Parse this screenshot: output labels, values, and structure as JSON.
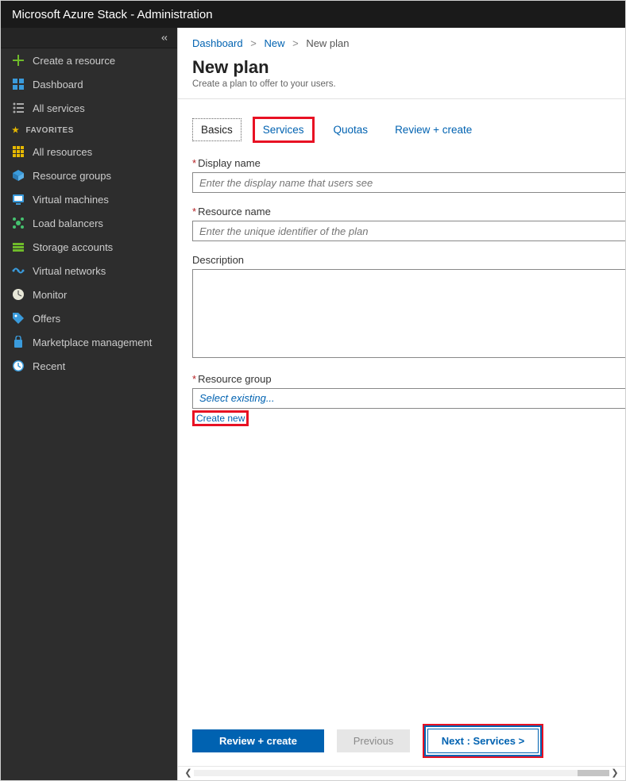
{
  "topbar": {
    "title": "Microsoft Azure Stack - Administration"
  },
  "sidebar": {
    "create": "Create a resource",
    "dashboard": "Dashboard",
    "all_services": "All services",
    "favorites_label": "FAVORITES",
    "items": [
      {
        "label": "All resources"
      },
      {
        "label": "Resource groups"
      },
      {
        "label": "Virtual machines"
      },
      {
        "label": "Load balancers"
      },
      {
        "label": "Storage accounts"
      },
      {
        "label": "Virtual networks"
      },
      {
        "label": "Monitor"
      },
      {
        "label": "Offers"
      },
      {
        "label": "Marketplace management"
      },
      {
        "label": "Recent"
      }
    ]
  },
  "breadcrumbs": {
    "dashboard": "Dashboard",
    "new": "New",
    "current": "New plan"
  },
  "page": {
    "title": "New plan",
    "subtitle": "Create a plan to offer to your users."
  },
  "tabs": {
    "basics": "Basics",
    "services": "Services",
    "quotas": "Quotas",
    "review": "Review + create"
  },
  "form": {
    "display_name_label": "Display name",
    "display_name_placeholder": "Enter the display name that users see",
    "resource_name_label": "Resource name",
    "resource_name_placeholder": "Enter the unique identifier of the plan",
    "description_label": "Description",
    "resource_group_label": "Resource group",
    "resource_group_placeholder": "Select existing...",
    "create_new": "Create new"
  },
  "footer": {
    "review": "Review + create",
    "previous": "Previous",
    "next": "Next : Services >"
  }
}
